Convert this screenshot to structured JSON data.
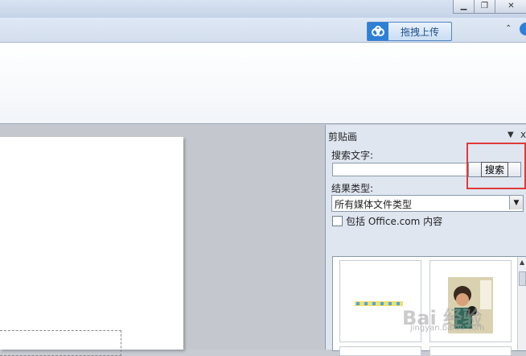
{
  "window": {
    "minimize_glyph": "▁",
    "maximize_glyph": "❐",
    "close_glyph": "✕"
  },
  "toolbar": {
    "upload_label": "拖拽上传",
    "collapse_glyph": "⌃"
  },
  "clipart_pane": {
    "title": "剪贴画",
    "menu_glyph": "▼",
    "close_glyph": "x",
    "search_label": "搜索文字:",
    "search_value": "",
    "search_button": "搜索",
    "result_type_label": "结果类型:",
    "result_type_value": "所有媒体文件类型",
    "include_office_label": "包括 Office.com 内容",
    "include_office_checked": false
  },
  "watermark": {
    "text": "Bai 经验",
    "url": "jingyan.baidu.com"
  },
  "colors": {
    "highlight": "#e03a3a",
    "accent": "#2e7fd6"
  }
}
